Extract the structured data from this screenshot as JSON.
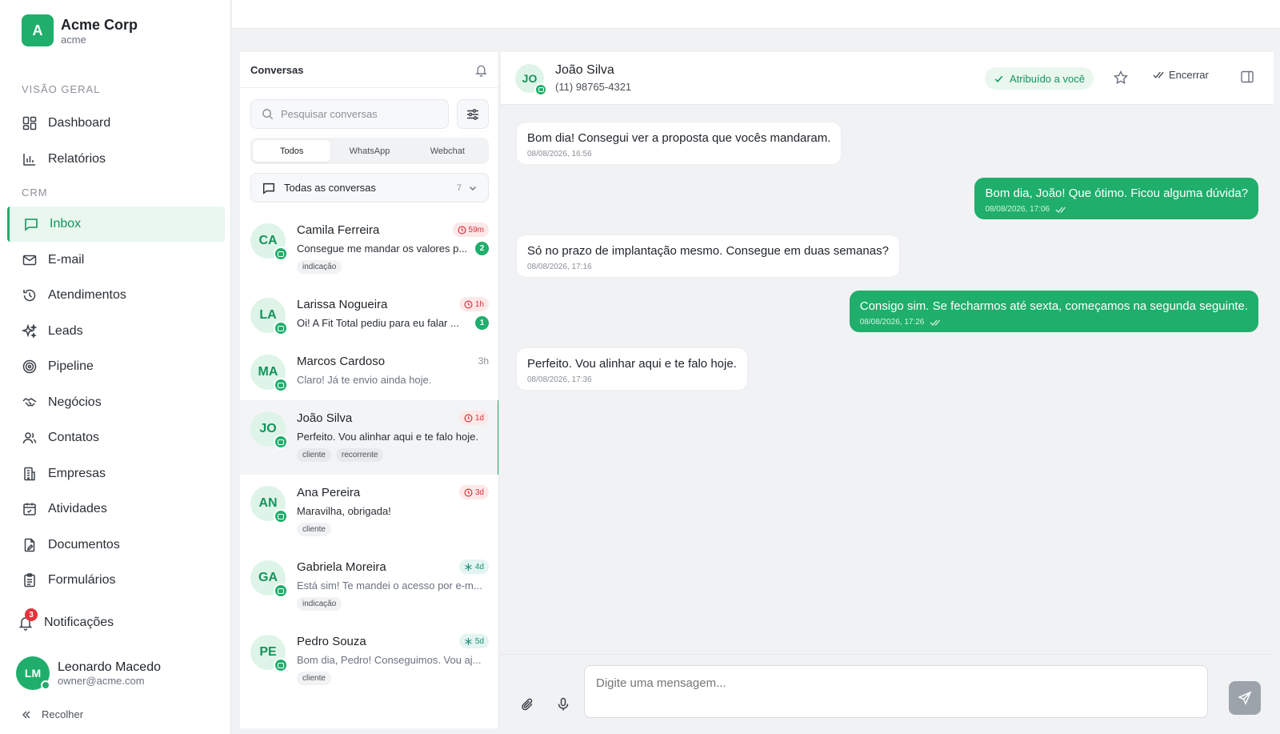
{
  "brand": {
    "logo_letter": "A",
    "name": "Acme Corp",
    "slug": "acme"
  },
  "sidebar": {
    "section_overview": "VISÃO GERAL",
    "section_crm": "CRM",
    "items": [
      {
        "label": "Dashboard",
        "icon": "dashboard-icon"
      },
      {
        "label": "Relatórios",
        "icon": "chart-icon"
      },
      {
        "label": "Inbox",
        "icon": "inbox-icon"
      },
      {
        "label": "E-mail",
        "icon": "mail-icon"
      },
      {
        "label": "Atendimentos",
        "icon": "history-icon"
      },
      {
        "label": "Leads",
        "icon": "sparkles-icon"
      },
      {
        "label": "Pipeline",
        "icon": "target-icon"
      },
      {
        "label": "Negócios",
        "icon": "handshake-icon"
      },
      {
        "label": "Contatos",
        "icon": "users-icon"
      },
      {
        "label": "Empresas",
        "icon": "building-icon"
      },
      {
        "label": "Atividades",
        "icon": "calendar-icon"
      },
      {
        "label": "Documentos",
        "icon": "document-icon"
      },
      {
        "label": "Formulários",
        "icon": "clipboard-icon"
      }
    ],
    "notifications": {
      "label": "Notificações",
      "count": "3"
    },
    "user": {
      "initials": "LM",
      "name": "Leonardo Macedo",
      "email": "owner@acme.com"
    },
    "collapse_label": "Recolher"
  },
  "conversations": {
    "title": "Conversas",
    "search_placeholder": "Pesquisar conversas",
    "tabs": [
      "Todos",
      "WhatsApp",
      "Webchat"
    ],
    "filter": {
      "label": "Todas as conversas",
      "count": "7"
    },
    "items": [
      {
        "initials": "CA",
        "name": "Camila Ferreira",
        "time": "59m",
        "badge": "red",
        "message": "Consegue me mandar os valores p...",
        "unread": "2",
        "tags": [
          "indicação"
        ]
      },
      {
        "initials": "LA",
        "name": "Larissa Nogueira",
        "time": "1h",
        "badge": "red",
        "message": "Oi! A Fit Total pediu para eu falar ...",
        "unread": "1",
        "tags": []
      },
      {
        "initials": "MA",
        "name": "Marcos Cardoso",
        "time": "3h",
        "badge": "plain",
        "message": "Claro! Já te envio ainda hoje.",
        "unread": "",
        "tags": []
      },
      {
        "initials": "JO",
        "name": "João Silva",
        "time": "1d",
        "badge": "red",
        "message": "Perfeito. Vou alinhar aqui e te falo hoje.",
        "unread": "",
        "tags": [
          "cliente",
          "recorrente"
        ]
      },
      {
        "initials": "AN",
        "name": "Ana Pereira",
        "time": "3d",
        "badge": "red",
        "message": "Maravilha, obrigada!",
        "unread": "",
        "tags": [
          "cliente"
        ]
      },
      {
        "initials": "GA",
        "name": "Gabriela Moreira",
        "time": "4d",
        "badge": "teal",
        "message": "Está sim! Te mandei o acesso por e-m...",
        "unread": "",
        "tags": [
          "indicação"
        ]
      },
      {
        "initials": "PE",
        "name": "Pedro Souza",
        "time": "5d",
        "badge": "teal",
        "message": "Bom dia, Pedro! Conseguimos. Vou aj...",
        "unread": "",
        "tags": [
          "cliente"
        ]
      }
    ]
  },
  "chat": {
    "contact": {
      "initials": "JO",
      "name": "João Silva",
      "phone": "(11) 98765-4321"
    },
    "assigned_label": "Atribuído a você",
    "close_label": "Encerrar",
    "messages": [
      {
        "dir": "in",
        "text": "Bom dia! Consegui ver a proposta que vocês mandaram.",
        "time": "08/08/2026, 16:56"
      },
      {
        "dir": "out",
        "text": "Bom dia, João! Que ótimo. Ficou alguma dúvida?",
        "time": "08/08/2026, 17:06"
      },
      {
        "dir": "in",
        "text": "Só no prazo de implantação mesmo. Consegue em duas semanas?",
        "time": "08/08/2026, 17:16"
      },
      {
        "dir": "out",
        "text": "Consigo sim. Se fecharmos até sexta, começamos na segunda seguinte.",
        "time": "08/08/2026, 17:26"
      },
      {
        "dir": "in",
        "text": "Perfeito. Vou alinhar aqui e te falo hoje.",
        "time": "08/08/2026, 17:36"
      }
    ],
    "input_placeholder": "Digite uma mensagem..."
  },
  "colors": {
    "accent": "#1fae6b",
    "alert": "#d9303a",
    "teal": "#1c8f77"
  }
}
